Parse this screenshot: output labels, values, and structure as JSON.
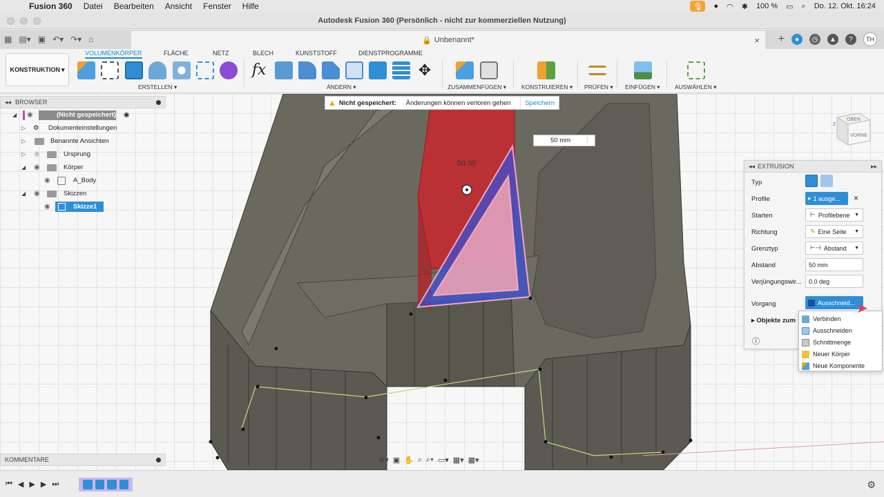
{
  "menubar": {
    "app_name": "Fusion 360",
    "items": [
      "Datei",
      "Bearbeiten",
      "Ansicht",
      "Fenster",
      "Hilfe"
    ],
    "battery": "100 %",
    "datetime": "Do. 12. Okt.  16:24"
  },
  "window": {
    "title": "Autodesk Fusion 360 (Persönlich - nicht zur kommerziellen Nutzung)",
    "document_tab": "Unbenannt*",
    "user_initials": "TH"
  },
  "toolbar": {
    "workspace": "KONSTRUKTION",
    "tabs": [
      "VOLUMENKÖRPER",
      "FLÄCHE",
      "NETZ",
      "BLECH",
      "KUNSTSTOFF",
      "DIENSTPROGRAMME"
    ],
    "active_tab": "VOLUMENKÖRPER",
    "groups": [
      "ERSTELLEN",
      "ÄNDERN",
      "ZUSAMMENFÜGEN",
      "KONSTRUIEREN",
      "PRÜFEN",
      "EINFÜGEN",
      "AUSWÄHLEN"
    ]
  },
  "browser": {
    "title": "BROWSER",
    "root": "(Nicht gespeichert)",
    "items": [
      "Dokumenteinstellungen",
      "Benannte Ansichten",
      "Ursprung",
      "Körper",
      "A_Body",
      "Skizzen",
      "Skizze1"
    ]
  },
  "warning": {
    "title": "Nicht gespeichert:",
    "message": "Änderungen können verloren gehen",
    "action": "Speichern"
  },
  "viewport": {
    "dimension_value": "50 mm",
    "dimension_label": "50.00",
    "viewcube_top": "OBEN",
    "viewcube_front": "VORNE"
  },
  "extrusion": {
    "title": "EXTRUSION",
    "labels": {
      "typ": "Typ",
      "profile": "Profile",
      "starten": "Starten",
      "richtung": "Richtung",
      "grenztyp": "Grenztyp",
      "abstand": "Abstand",
      "verjuengung": "Verjüngungswir...",
      "vorgang": "Vorgang",
      "objekte": "Objekte zum"
    },
    "values": {
      "profile": "1 ausge...",
      "starten": "Profilebene",
      "richtung": "Eine Seite",
      "grenztyp": "Abstand",
      "abstand": "50 mm",
      "verjuengung": "0.0 deg",
      "vorgang": "Ausschneid..."
    },
    "operation_options": [
      "Verbinden",
      "Ausschneiden",
      "Schnittmenge",
      "Neuer Körper",
      "Neue Komponente"
    ]
  },
  "comments": {
    "title": "KOMMENTARE"
  },
  "colors": {
    "accent": "#1b8ad1",
    "cut_red": "#d41f26",
    "body_gray": "#6b6a60"
  }
}
